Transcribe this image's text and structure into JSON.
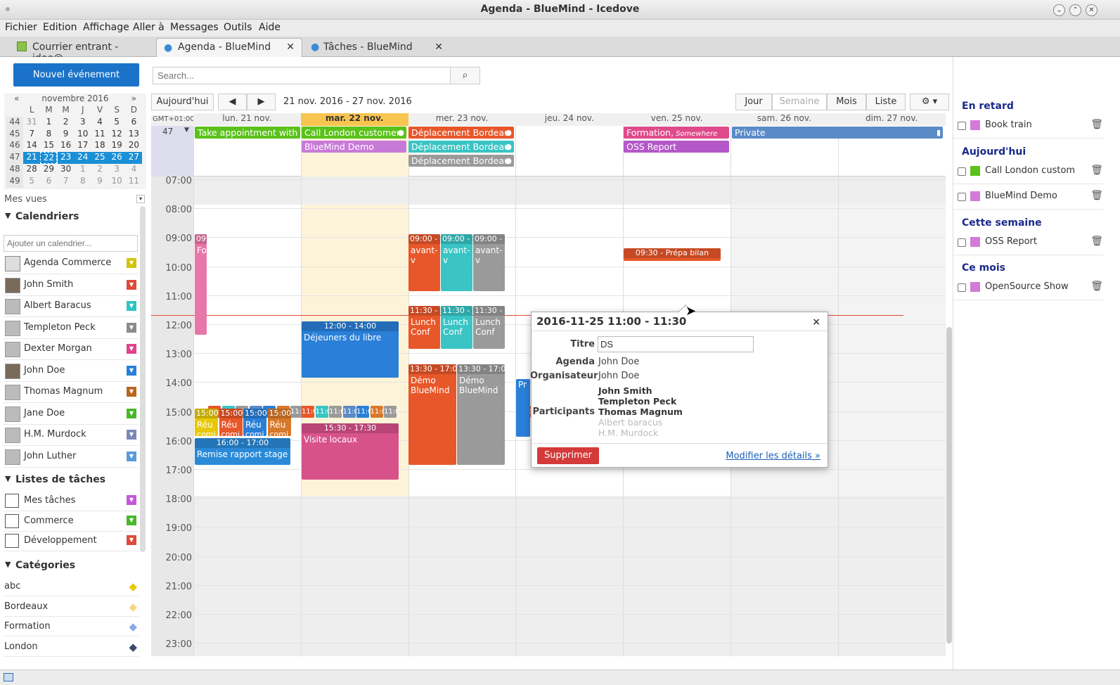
{
  "window": {
    "title": "Agenda - BlueMind - Icedove"
  },
  "menu": [
    "Fichier",
    "Edition",
    "Affichage",
    "Aller à",
    "Messages",
    "Outils",
    "Aide"
  ],
  "tabs": [
    {
      "label": "Courrier entrant - jdoe@..."
    },
    {
      "label": "Agenda - BlueMind"
    },
    {
      "label": "Tâches - BlueMind"
    }
  ],
  "new_event_label": "Nouvel événement",
  "search": {
    "placeholder": "Search..."
  },
  "minical": {
    "month": "novembre 2016",
    "day_headers": [
      "L",
      "M",
      "M",
      "J",
      "V",
      "S",
      "D"
    ],
    "weeks": [
      {
        "wk": "44",
        "days": [
          "31",
          "1",
          "2",
          "3",
          "4",
          "5",
          "6"
        ]
      },
      {
        "wk": "45",
        "days": [
          "7",
          "8",
          "9",
          "10",
          "11",
          "12",
          "13"
        ]
      },
      {
        "wk": "46",
        "days": [
          "14",
          "15",
          "16",
          "17",
          "18",
          "19",
          "20"
        ]
      },
      {
        "wk": "47",
        "days": [
          "21",
          "22",
          "23",
          "24",
          "25",
          "26",
          "27"
        ]
      },
      {
        "wk": "48",
        "days": [
          "28",
          "29",
          "30",
          "1",
          "2",
          "3",
          "4"
        ]
      },
      {
        "wk": "49",
        "days": [
          "5",
          "6",
          "7",
          "8",
          "9",
          "10",
          "11"
        ]
      }
    ]
  },
  "sidebar": {
    "views_label": "Mes vues",
    "calendars_label": "Calendriers",
    "add_calendar_placeholder": "Ajouter un calendrier...",
    "calendars": [
      {
        "name": "Agenda Commerce",
        "color": "#d4c20a"
      },
      {
        "name": "John Smith",
        "color": "#e04a3a"
      },
      {
        "name": "Albert Baracus",
        "color": "#2ec4c4"
      },
      {
        "name": "Templeton Peck",
        "color": "#8a8a8a"
      },
      {
        "name": "Dexter Morgan",
        "color": "#e0448a"
      },
      {
        "name": "John Doe",
        "color": "#2a7fd8"
      },
      {
        "name": "Thomas Magnum",
        "color": "#b8661e"
      },
      {
        "name": "Jane Doe",
        "color": "#49b82a"
      },
      {
        "name": "H.M. Murdock",
        "color": "#7a8ab8"
      },
      {
        "name": "John Luther",
        "color": "#5a9ad8"
      }
    ],
    "tasklists_label": "Listes de tâches",
    "tasklists": [
      {
        "name": "Mes tâches",
        "color": "#c458d8"
      },
      {
        "name": "Commerce",
        "color": "#49b82a"
      },
      {
        "name": "Développement",
        "color": "#e04a3a"
      }
    ],
    "categories_label": "Catégories",
    "categories": [
      {
        "name": "abc",
        "color": "#e8c80a"
      },
      {
        "name": "Bordeaux",
        "color": "#f5d880"
      },
      {
        "name": "Formation",
        "color": "#8aaae8"
      },
      {
        "name": "London",
        "color": "#3a4a6a"
      }
    ]
  },
  "toolbar": {
    "today": "Aujourd'hui",
    "prev": "◀",
    "next": "▶",
    "range": "21 nov. 2016 - 27 nov. 2016",
    "views": [
      "Jour",
      "Semaine",
      "Mois",
      "Liste"
    ],
    "settings": "⚙ ▾"
  },
  "grid": {
    "tz": "GMT+01:00",
    "week": "47",
    "days": [
      "lun. 21 nov.",
      "mar. 22 nov.",
      "mer. 23 nov.",
      "jeu. 24 nov.",
      "ven. 25 nov.",
      "sam. 26 nov.",
      "dim. 27 nov."
    ],
    "hours": [
      "07:00",
      "08:00",
      "09:00",
      "10:00",
      "11:00",
      "12:00",
      "13:00",
      "14:00",
      "15:00",
      "16:00",
      "17:00",
      "18:00",
      "19:00",
      "20:00",
      "21:00",
      "22:00",
      "23:00"
    ],
    "allday": [
      {
        "title": "Take appointment with N",
        "color": "#5ac21a"
      },
      {
        "title": "Call London customer",
        "color": "#5ac21a"
      },
      {
        "title": "BlueMind Demo",
        "color": "#c87ad8"
      },
      {
        "title": "Déplacement Bordeau",
        "color": "#e8572a"
      },
      {
        "title": "Déplacement Bordeau",
        "color": "#3ac4c4"
      },
      {
        "title": "Déplacement Bordeau",
        "color": "#9a9a9a"
      },
      {
        "title": "Formation,",
        "location": "Somewhere",
        "color": "#e04a8a"
      },
      {
        "title": "OSS Report",
        "color": "#b458c8"
      },
      {
        "title": "Private",
        "color": "#5a8ac8"
      }
    ],
    "events": {
      "mon_fo": {
        "time": "09:0",
        "title": "Fo"
      },
      "dej": {
        "time": "12:00 - 14:00",
        "title": "Déjeuners du libre"
      },
      "visite": {
        "time": "15:30 - 17:30",
        "title": "Visite locaux"
      },
      "remise": {
        "time": "16:00 - 17:00",
        "title": "Remise rapport stage"
      },
      "reu": {
        "time": "15:00 -",
        "title": "Réu",
        "sub": "comi"
      },
      "avant1": {
        "time": "09:00 - 11",
        "title": "avant-v"
      },
      "lunch": {
        "time": "11:30 - 13",
        "title": "Lunch Conf"
      },
      "demo1": {
        "time": "13:30 - 17:00",
        "title": "Démo BlueMind"
      },
      "prepa": {
        "time": "09:30 - Prépa bilan"
      },
      "thu_pr": {
        "title": "Pr"
      },
      "mini": "11:0"
    }
  },
  "popup": {
    "title": "2016-11-25 11:00 - 11:30",
    "close": "×",
    "titre_label": "Titre",
    "titre_value": "DS",
    "agenda_label": "Agenda",
    "agenda_value": "John Doe",
    "org_label": "Organisateur",
    "org_value": "John Doe",
    "part_label": "Participants",
    "participants": [
      {
        "name": "John Smith",
        "status": "accepted"
      },
      {
        "name": "Templeton Peck",
        "status": "accepted"
      },
      {
        "name": "Thomas Magnum",
        "status": "accepted"
      },
      {
        "name": "Albert baracus",
        "status": "pending"
      },
      {
        "name": "H.M. Murdock",
        "status": "pending"
      }
    ],
    "delete": "Supprimer",
    "modify": "Modifier les détails »"
  },
  "rpanel": {
    "sections": [
      {
        "label": "En retard",
        "tasks": [
          {
            "name": "Book train",
            "color": "#d47ad8"
          }
        ]
      },
      {
        "label": "Aujourd'hui",
        "tasks": [
          {
            "name": "Call London custom",
            "color": "#5ac21a"
          },
          {
            "name": "BlueMind Demo",
            "color": "#d47ad8"
          }
        ]
      },
      {
        "label": "Cette semaine",
        "tasks": [
          {
            "name": "OSS Report",
            "color": "#d47ad8"
          }
        ]
      },
      {
        "label": "Ce mois",
        "tasks": [
          {
            "name": "OpenSource Show",
            "color": "#d47ad8"
          }
        ]
      }
    ]
  }
}
